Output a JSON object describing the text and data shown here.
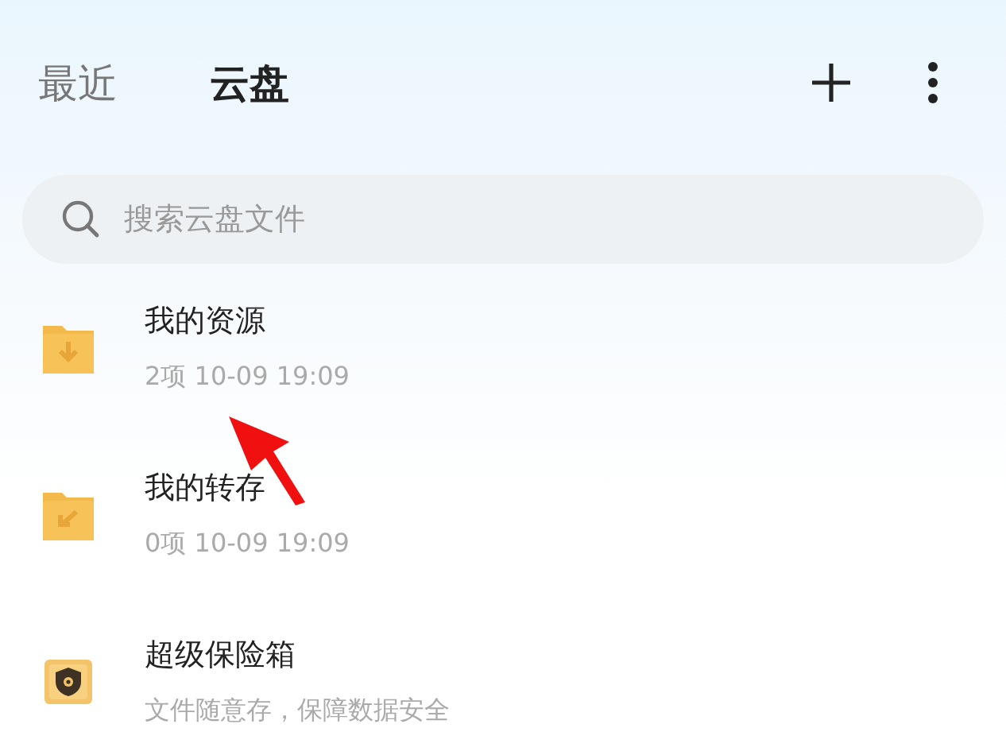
{
  "tabs": [
    {
      "label": "最近",
      "selected": false
    },
    {
      "label": "云盘",
      "selected": true
    }
  ],
  "search": {
    "placeholder": "搜索云盘文件"
  },
  "items": [
    {
      "kind": "download-folder",
      "title": "我的资源",
      "subtitle": "2项 10-09 19:09"
    },
    {
      "kind": "return-folder",
      "title": "我的转存",
      "subtitle": "0项 10-09 19:09"
    },
    {
      "kind": "safe",
      "title": "超级保险箱",
      "subtitle": "文件随意存，保障数据安全"
    }
  ]
}
